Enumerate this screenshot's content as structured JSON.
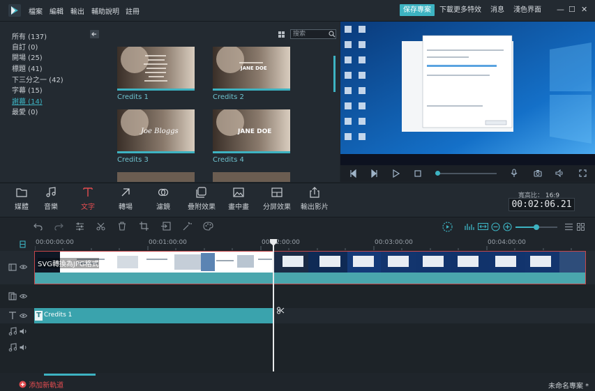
{
  "menu": {
    "file": "檔案",
    "edit": "編輯",
    "export": "輸出",
    "help": "輔助說明",
    "register": "註冊"
  },
  "top_actions": {
    "save_project": "保存專案",
    "download_effects": "下載更多特效",
    "messages": "消息",
    "light_theme": "淺色界面"
  },
  "library": {
    "categories": [
      {
        "label": "所有 (137)"
      },
      {
        "label": "自訂 (0)"
      },
      {
        "label": "開場 (25)"
      },
      {
        "label": "標題 (41)"
      },
      {
        "label": "下三分之一 (42)"
      },
      {
        "label": "字幕 (15)"
      },
      {
        "label": "謝幕 (14)",
        "active": true
      },
      {
        "label": "最愛 (0)"
      }
    ],
    "search_placeholder": "搜索",
    "thumbnails": [
      {
        "label": "Credits 1",
        "overlay": ""
      },
      {
        "label": "Credits 2",
        "overlay": "JANE DOE"
      },
      {
        "label": "Credits 3",
        "overlay": "Joe Bloggs"
      },
      {
        "label": "Credits 4",
        "overlay": "JANE DOE"
      }
    ]
  },
  "toolbar": {
    "items": [
      {
        "key": "media",
        "label": "媒體"
      },
      {
        "key": "music",
        "label": "音樂"
      },
      {
        "key": "text",
        "label": "文字",
        "active": true
      },
      {
        "key": "transition",
        "label": "轉場"
      },
      {
        "key": "filter",
        "label": "濾鏡"
      },
      {
        "key": "overlay",
        "label": "疊附效果"
      },
      {
        "key": "pip",
        "label": "畫中畫"
      },
      {
        "key": "split",
        "label": "分屏效果"
      },
      {
        "key": "export",
        "label": "輸出影片"
      }
    ],
    "aspect_label": "寬高比：",
    "aspect_value": "16:9",
    "timecode": "00:02:06.21"
  },
  "timeline": {
    "ruler": [
      "00:00:00:00",
      "00:01:00:00",
      "00:02:00:00",
      "00:03:00:00",
      "00:04:00:00"
    ],
    "video_clip_title": "SVG轉換為JPG格式",
    "credits_clip_label": "Credits 1"
  },
  "footer": {
    "add_track": "添加新軌道",
    "project_name": "未命名專案 *"
  },
  "colors": {
    "accent": "#3db3c2",
    "danger": "#e34c50",
    "bg": "#1f252b"
  }
}
